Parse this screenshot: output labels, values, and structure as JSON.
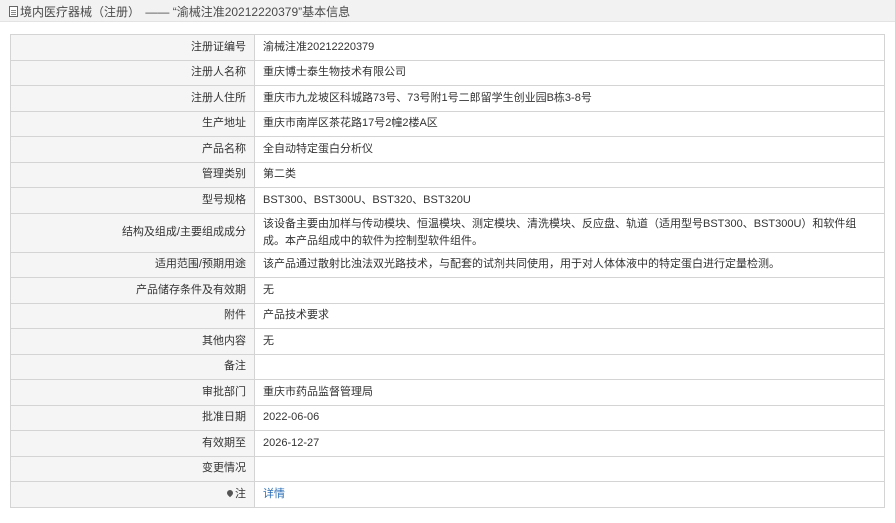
{
  "breadcrumb": {
    "category": "境内医疗器械（注册）",
    "separator": "——",
    "title": "“渝械注准20212220379”基本信息"
  },
  "fields": {
    "reg_no": {
      "label": "注册证编号",
      "value": "渝械注准20212220379"
    },
    "registrant": {
      "label": "注册人名称",
      "value": "重庆博士泰生物技术有限公司"
    },
    "registrant_address": {
      "label": "注册人住所",
      "value": "重庆市九龙坡区科城路73号、73号附1号二郎留学生创业园B栋3-8号"
    },
    "production_address": {
      "label": "生产地址",
      "value": "重庆市南岸区茶花路17号2幢2楼A区"
    },
    "product_name": {
      "label": "产品名称",
      "value": "全自动特定蛋白分析仪"
    },
    "management_class": {
      "label": "管理类别",
      "value": "第二类"
    },
    "model_spec": {
      "label": "型号规格",
      "value": "BST300、BST300U、BST320、BST320U"
    },
    "composition": {
      "label": "结构及组成/主要组成成分",
      "value": "该设备主要由加样与传动模块、恒温模块、测定模块、清洗模块、反应盘、轨道（适用型号BST300、BST300U）和软件组成。本产品组成中的软件为控制型软件组件。"
    },
    "intended_use": {
      "label": "适用范围/预期用途",
      "value": "该产品通过散射比浊法双光路技术，与配套的试剂共同使用，用于对人体体液中的特定蛋白进行定量检测。"
    },
    "storage": {
      "label": "产品储存条件及有效期",
      "value": "无"
    },
    "attachment": {
      "label": "附件",
      "value": "产品技术要求"
    },
    "other": {
      "label": "其他内容",
      "value": "无"
    },
    "remark": {
      "label": "备注",
      "value": ""
    },
    "approval_dept": {
      "label": "审批部门",
      "value": "重庆市药品监督管理局"
    },
    "approval_date": {
      "label": "批准日期",
      "value": "2022-06-06"
    },
    "valid_until": {
      "label": "有效期至",
      "value": "2026-12-27"
    },
    "change": {
      "label": "变更情况",
      "value": ""
    },
    "note": {
      "label": "注",
      "value": "详情",
      "icon": "map-pin-icon"
    }
  }
}
